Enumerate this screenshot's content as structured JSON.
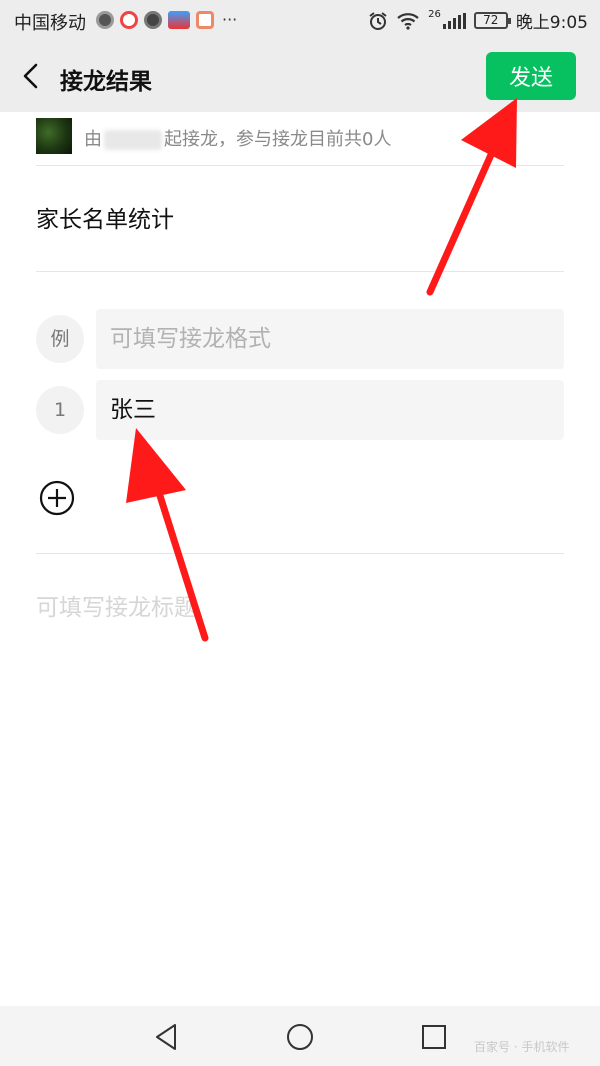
{
  "status_bar": {
    "carrier": "中国移动",
    "network_badge": "26",
    "battery": "72",
    "time": "晚上9:05",
    "more": "···"
  },
  "header": {
    "title": "接龙结果",
    "send_label": "发送"
  },
  "creator": {
    "prefix": "由",
    "suffix": "起接龙，参与接龙目前共0人"
  },
  "main_title": "家长名单统计",
  "entries": [
    {
      "badge": "例",
      "text": "可填写接龙格式",
      "placeholder": true
    },
    {
      "badge": "1",
      "text": "张三",
      "placeholder": false
    }
  ],
  "title_placeholder": "可填写接龙标题",
  "watermark": "百家号 · 手机软件",
  "colors": {
    "accent": "#07c160",
    "arrow": "#ff1a1a"
  }
}
